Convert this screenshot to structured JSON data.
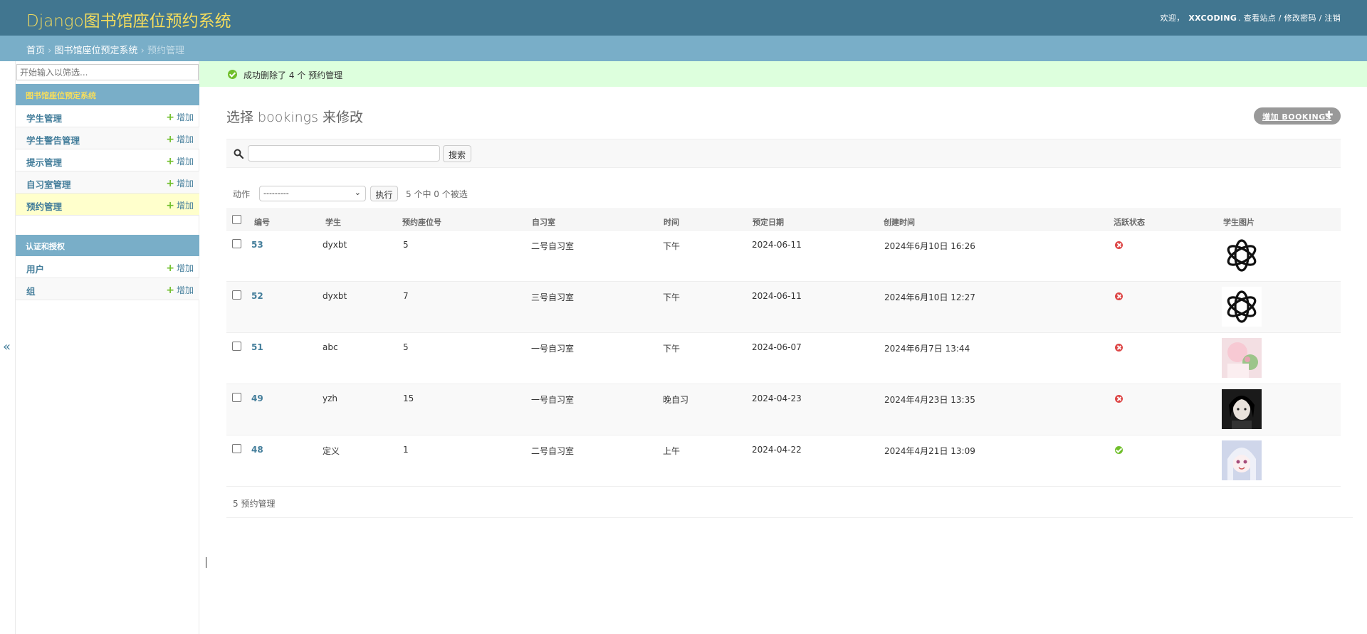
{
  "header": {
    "branding": "Django图书馆座位预约系统",
    "welcome": "欢迎，",
    "username": "XXCODING",
    "view_site": "查看站点",
    "change_password": "修改密码",
    "logout": "注销",
    "sep": "/"
  },
  "breadcrumbs": {
    "home": "首页",
    "app": "图书馆座位预定系统",
    "current": "预约管理",
    "sep": "›"
  },
  "sidebar": {
    "filter_placeholder": "开始输入以筛选...",
    "add_label": "增加",
    "apps": [
      {
        "caption": "图书馆座位预定系统",
        "models": [
          "学生管理",
          "学生警告管理",
          "提示管理",
          "自习室管理",
          "预约管理"
        ]
      },
      {
        "caption": "认证和授权",
        "models": [
          "用户",
          "组"
        ]
      }
    ],
    "collapse_glyph": "«"
  },
  "messages": {
    "success": "成功删除了 4 个 预约管理"
  },
  "content": {
    "title": "选择 bookings 来修改",
    "add_button": "增加 BOOKINGS",
    "search_button": "搜索",
    "action_label": "动作",
    "action_selected": "---------",
    "action_go": "执行",
    "action_counter": "5 个中 0 个被选"
  },
  "table": {
    "columns": [
      "编号",
      "学生",
      "预约座位号",
      "自习室",
      "时间",
      "预定日期",
      "创建时间",
      "活跃状态",
      "学生图片"
    ],
    "rows": [
      {
        "id": "53",
        "student": "dyxbt",
        "seat": "5",
        "room": "二号自习室",
        "time": "下午",
        "date": "2024-06-11",
        "created": "2024年6月10日 16:26",
        "active": false,
        "image": "logo"
      },
      {
        "id": "52",
        "student": "dyxbt",
        "seat": "7",
        "room": "三号自习室",
        "time": "下午",
        "date": "2024-06-11",
        "created": "2024年6月10日 12:27",
        "active": false,
        "image": "logo"
      },
      {
        "id": "51",
        "student": "abc",
        "seat": "5",
        "room": "一号自习室",
        "time": "下午",
        "date": "2024-06-07",
        "created": "2024年6月7日 13:44",
        "active": false,
        "image": "pink"
      },
      {
        "id": "49",
        "student": "yzh",
        "seat": "15",
        "room": "一号自习室",
        "time": "晚自习",
        "date": "2024-04-23",
        "created": "2024年4月23日 13:35",
        "active": false,
        "image": "dark"
      },
      {
        "id": "48",
        "student": "定义",
        "seat": "1",
        "room": "二号自习室",
        "time": "上午",
        "date": "2024-04-22",
        "created": "2024年4月21日 13:09",
        "active": true,
        "image": "white"
      }
    ]
  },
  "paginator": "5 预约管理",
  "colors": {
    "header_bg": "#417690",
    "breadcrumb_bg": "#79aec8",
    "branding": "#f5dd5d",
    "link": "#447e9b",
    "success_bg": "#dddddd",
    "add_green": "#70bf2b",
    "error_red": "#dd4646"
  }
}
